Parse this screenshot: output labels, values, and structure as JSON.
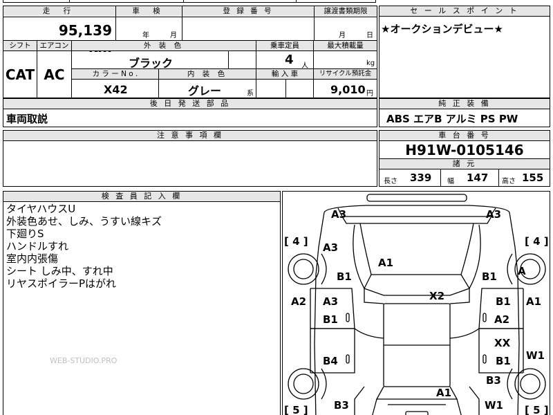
{
  "top_row": {
    "mileage_header": "走 行",
    "mileage_value": "95,139 km",
    "inspection_header": "車 検",
    "inspection_year": "年",
    "inspection_month": "月",
    "registration_header": "登 録 番 号",
    "transfer_header": "譲渡書類期限",
    "transfer_month": "月",
    "transfer_day": "日",
    "shift_header": "シフト",
    "shift_value": "CAT",
    "ac_header": "エアコン",
    "ac_value": "AC",
    "exterior_color_header": "外 装 色",
    "exterior_color_value": "ブラック",
    "color_no_header": "カ ラ ー N o .",
    "color_no_value": "X42",
    "interior_color_header": "内 装 色",
    "interior_color_value": "グレー",
    "interior_color_suffix": "系",
    "capacity_header": "乗車定員",
    "capacity_value": "4",
    "capacity_unit": "人",
    "max_load_header": "最大積載量",
    "max_load_unit": "kg",
    "import_header": "輸 入 車",
    "recycle_header": "リサイクル預託金",
    "recycle_value": "9,010",
    "recycle_unit": "円"
  },
  "sales_point": {
    "header": "セ ー ル ス ポ イ ン ト",
    "text": "★オークションデビュー★"
  },
  "later_parts": {
    "header": "後 日 発 送 部 品",
    "text": "車両取説"
  },
  "equipment": {
    "header": "純 正 装 備",
    "text": "ABS エアB アルミ PS PW"
  },
  "notes": {
    "header": "注 意 事 項 欄"
  },
  "chassis": {
    "header": "車 台 番 号",
    "value": "H91W-0105146",
    "dims_header": "諸 元",
    "length_label": "長さ",
    "length_value": "339",
    "width_label": "幅",
    "width_value": "147",
    "height_label": "高さ",
    "height_value": "155"
  },
  "inspector": {
    "header": "検 査 員 記 入 欄",
    "lines": [
      "タイヤハウスU",
      "外装色あせ、しみ、うすい線キズ",
      "下廻りS",
      "ハンドルすれ",
      "室内内張傷",
      "シート しみ中、すれ中",
      "リヤスポイラーPはがれ"
    ]
  },
  "watermark": "WEB-STUDIO.PRO",
  "diagram": {
    "marks": {
      "a3_top_left": "A3",
      "a3_top_right": "A3",
      "a3_left_fender": "A3",
      "a1_hood": "A1",
      "b1_left_front": "B1",
      "b1_right_front": "B1",
      "a_right_front_wheel": "A",
      "a2_left_side": "A2",
      "a3_left_door": "A3",
      "b1_left_door": "B1",
      "x2_roof": "X2",
      "b1_right_door": "B1",
      "a2_right_door": "A2",
      "a1_right_side": "A1",
      "xx_right_rear_door": "XX",
      "b4_left_rear_door": "B4",
      "b1_right_rear_door": "B1",
      "w1_right_side": "W1",
      "b3_right_rear": "B3",
      "a1_rear": "A1",
      "b3_left_rear": "B3",
      "w1_right_bottom": "W1"
    },
    "bracket_fl": "[ 4 ]",
    "bracket_fr": "[ 4 ]",
    "bracket_rl": "[ 5 ]",
    "bracket_rr": "[ 5 ]"
  }
}
